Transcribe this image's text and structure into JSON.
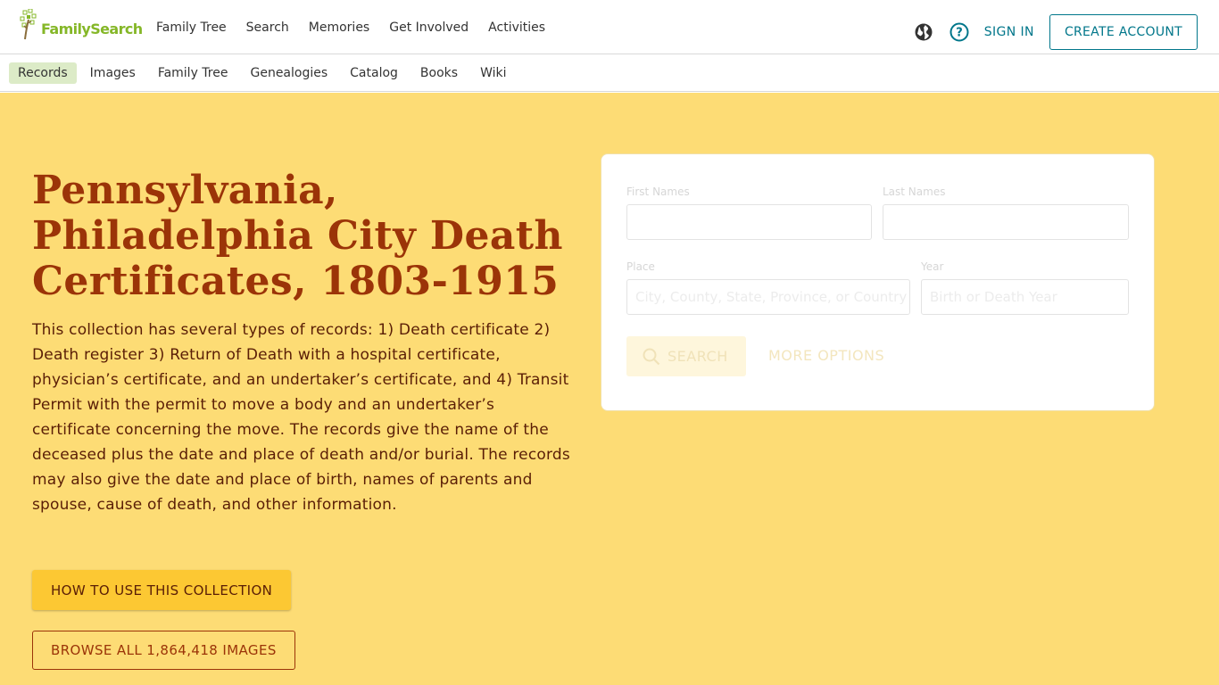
{
  "header": {
    "logo_text": "FamilySearch",
    "nav": [
      "Family Tree",
      "Search",
      "Memories",
      "Get Involved",
      "Activities"
    ],
    "sign_in": "SIGN IN",
    "create_account": "CREATE ACCOUNT",
    "icons": [
      "globe-icon",
      "help-icon"
    ]
  },
  "subnav": {
    "items": [
      "Records",
      "Images",
      "Family Tree",
      "Genealogies",
      "Catalog",
      "Books",
      "Wiki"
    ],
    "active": "Records"
  },
  "hero": {
    "title": "Pennsylvania, Philadelphia City Death Certificates, 1803-1915",
    "description": "This collection has several types of records: 1) Death certificate 2) Death register 3) Return of Death with a hospital certificate, physician’s certificate, and an undertaker’s certificate, and 4) Transit Permit with the permit to move a body and an undertaker’s certificate concerning the move. The records give the name of the deceased plus the date and place of death and/or burial. The records may also give the date and place of birth, names of parents and spouse, cause of death, and other information.",
    "how_to_button": "HOW TO USE THIS COLLECTION",
    "browse_button": "BROWSE ALL 1,864,418 IMAGES"
  },
  "search": {
    "first_names_label": "First Names",
    "last_names_label": "Last Names",
    "place_label": "Place",
    "place_placeholder": "City, County, State, Province, or Country",
    "year_label": "Year",
    "year_placeholder": "Birth or Death Year",
    "search_button": "SEARCH",
    "more_options": "MORE OPTIONS"
  },
  "colors": {
    "hero_bg": "#fddc75",
    "title": "#9b3408",
    "accent_teal": "#00768a",
    "brand_green": "#85b728",
    "button_gold": "#fcc833"
  }
}
